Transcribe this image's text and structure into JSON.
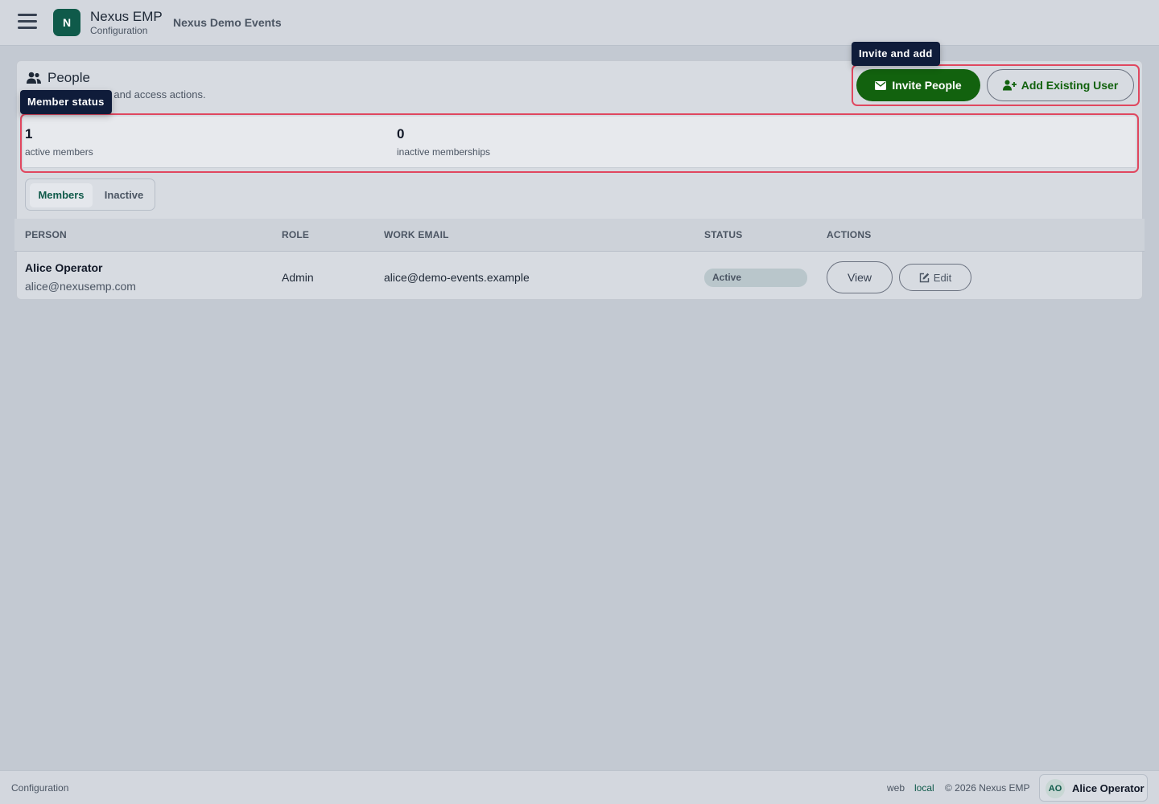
{
  "header": {
    "logo_letter": "N",
    "app_name": "Nexus EMP",
    "app_subtitle": "Configuration",
    "org_name": "Nexus Demo Events"
  },
  "people_card": {
    "title": "People",
    "description": "Manage members and access actions.",
    "invite_button": "Invite People",
    "add_existing_button": "Add Existing User"
  },
  "tooltips": {
    "member_status": "Member status",
    "invite_and_add": "Invite and add"
  },
  "stats": [
    {
      "value": "1",
      "label": "active members"
    },
    {
      "value": "0",
      "label": "inactive memberships"
    }
  ],
  "tabs": [
    {
      "label": "Members",
      "selected": true
    },
    {
      "label": "Inactive",
      "selected": false
    }
  ],
  "table": {
    "columns": [
      "PERSON",
      "ROLE",
      "WORK EMAIL",
      "STATUS",
      "ACTIONS"
    ],
    "rows": [
      {
        "name": "Alice Operator",
        "email": "alice@nexusemp.com",
        "role": "Admin",
        "work_email": "alice@demo-events.example",
        "status": "Active",
        "view_label": "View",
        "edit_label": "Edit"
      }
    ]
  },
  "footer": {
    "section": "Configuration",
    "channel": "web",
    "env": "local",
    "copyright": "© 2026 Nexus EMP",
    "user_initials": "AO",
    "user_name": "Alice Operator"
  },
  "colors": {
    "brand": "#0f5a4a",
    "primary_button": "#12620e",
    "highlight": "#e0475f",
    "tooltip_bg": "#0f1c3a"
  },
  "icons": [
    "menu-icon",
    "people-icon",
    "envelope-icon",
    "user-plus-icon",
    "edit-icon"
  ]
}
